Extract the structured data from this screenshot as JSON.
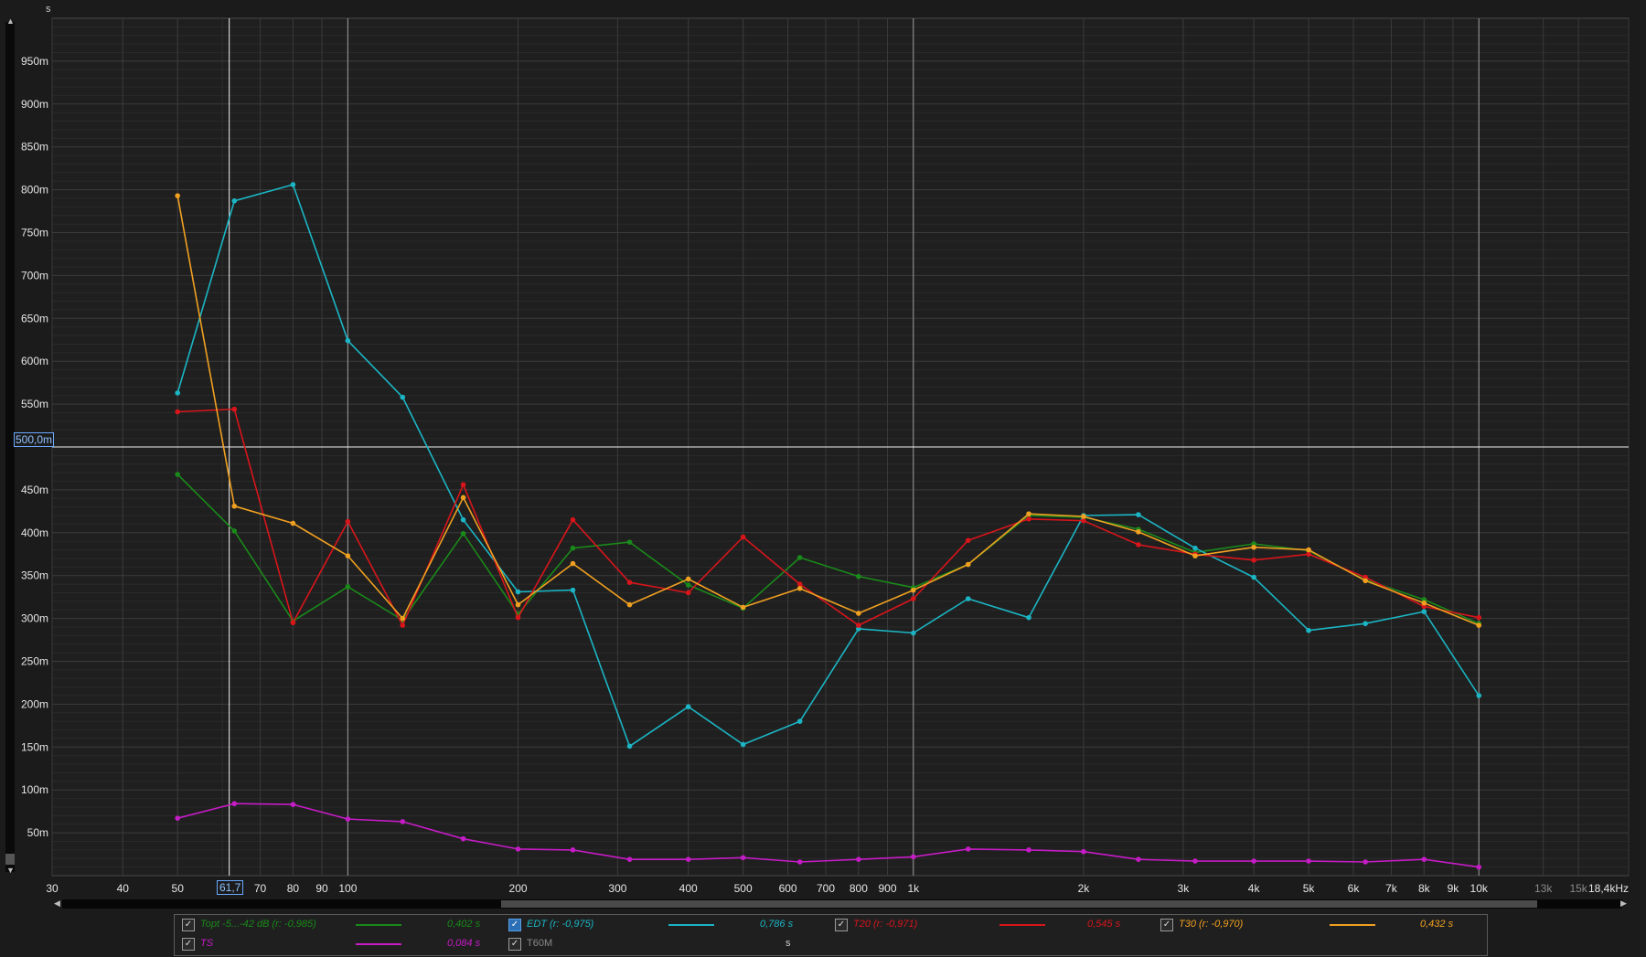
{
  "units": {
    "y_unit": "s",
    "x_unit_suffix": "kHz"
  },
  "cursor": {
    "x_readout": "61,7",
    "y_readout": "500,0m"
  },
  "legend": {
    "row1": [
      {
        "label": "Topt -5...-42 dB (r: -0,985)",
        "value": "0,402 s",
        "color": "#1a8a1a",
        "checked": true
      },
      {
        "label": "EDT (r: -0,975)",
        "value": "0,786 s",
        "color": "#1bb5c4",
        "checked": true
      },
      {
        "label": "T20 (r: -0,971)",
        "value": "0,545 s",
        "color": "#d8151b",
        "checked": true
      },
      {
        "label": "T30 (r: -0,970)",
        "value": "0,432 s",
        "color": "#f0a020",
        "checked": true
      }
    ],
    "row2": [
      {
        "label": "TS",
        "value": "0,084 s",
        "color": "#c61cc6",
        "checked": true
      },
      {
        "label": "T60M",
        "value": "s",
        "color": "#8a8a8a",
        "checked": true
      }
    ]
  },
  "chart_data": {
    "type": "line",
    "x_scale": "log",
    "xlim": [
      30,
      18400
    ],
    "ylim": [
      0,
      1.0
    ],
    "grid": true,
    "y_ticks": [
      {
        "v": 0.05,
        "label": "50m"
      },
      {
        "v": 0.1,
        "label": "100m"
      },
      {
        "v": 0.15,
        "label": "150m"
      },
      {
        "v": 0.2,
        "label": "200m"
      },
      {
        "v": 0.25,
        "label": "250m"
      },
      {
        "v": 0.3,
        "label": "300m"
      },
      {
        "v": 0.35,
        "label": "350m"
      },
      {
        "v": 0.4,
        "label": "400m"
      },
      {
        "v": 0.45,
        "label": "450m"
      },
      {
        "v": 0.55,
        "label": "550m"
      },
      {
        "v": 0.6,
        "label": "600m"
      },
      {
        "v": 0.65,
        "label": "650m"
      },
      {
        "v": 0.7,
        "label": "700m"
      },
      {
        "v": 0.75,
        "label": "750m"
      },
      {
        "v": 0.8,
        "label": "800m"
      },
      {
        "v": 0.85,
        "label": "850m"
      },
      {
        "v": 0.9,
        "label": "900m"
      },
      {
        "v": 0.95,
        "label": "950m"
      }
    ],
    "x_ticks": [
      {
        "v": 30,
        "label": "30"
      },
      {
        "v": 40,
        "label": "40"
      },
      {
        "v": 50,
        "label": "50"
      },
      {
        "v": 70,
        "label": "70"
      },
      {
        "v": 80,
        "label": "80"
      },
      {
        "v": 90,
        "label": "90"
      },
      {
        "v": 100,
        "label": "100"
      },
      {
        "v": 200,
        "label": "200"
      },
      {
        "v": 300,
        "label": "300"
      },
      {
        "v": 400,
        "label": "400"
      },
      {
        "v": 500,
        "label": "500"
      },
      {
        "v": 600,
        "label": "600"
      },
      {
        "v": 700,
        "label": "700"
      },
      {
        "v": 800,
        "label": "800"
      },
      {
        "v": 900,
        "label": "900"
      },
      {
        "v": 1000,
        "label": "1k"
      },
      {
        "v": 2000,
        "label": "2k"
      },
      {
        "v": 3000,
        "label": "3k"
      },
      {
        "v": 4000,
        "label": "4k"
      },
      {
        "v": 5000,
        "label": "5k"
      },
      {
        "v": 6000,
        "label": "6k"
      },
      {
        "v": 7000,
        "label": "7k"
      },
      {
        "v": 8000,
        "label": "8k"
      },
      {
        "v": 9000,
        "label": "9k"
      },
      {
        "v": 10000,
        "label": "10k"
      },
      {
        "v": 13000,
        "label": "13k",
        "dim": true
      },
      {
        "v": 15000,
        "label": "15k",
        "dim": true
      },
      {
        "v": 18400,
        "label": "18,4kHz"
      }
    ],
    "x": [
      50,
      63,
      80,
      100,
      125,
      160,
      200,
      250,
      315,
      400,
      500,
      630,
      800,
      1000,
      1250,
      1600,
      2000,
      2500,
      3150,
      4000,
      5000,
      6300,
      8000,
      10000
    ],
    "series": [
      {
        "name": "Topt -5...-42 dB (r: -0,985)",
        "color": "#1a8a1a",
        "values": [
          0.468,
          0.402,
          0.297,
          0.337,
          0.298,
          0.399,
          0.305,
          0.382,
          0.389,
          0.339,
          0.312,
          0.371,
          0.349,
          0.336,
          0.363,
          0.42,
          0.418,
          0.404,
          0.377,
          0.387,
          0.379,
          0.345,
          0.322,
          0.294
        ]
      },
      {
        "name": "EDT (r: -0,975)",
        "color": "#1bb5c4",
        "values": [
          0.563,
          0.787,
          0.806,
          0.624,
          0.558,
          0.415,
          0.331,
          0.333,
          0.151,
          0.197,
          0.153,
          0.18,
          0.288,
          0.283,
          0.323,
          0.301,
          0.42,
          0.421,
          0.382,
          0.348,
          0.286,
          0.294,
          0.308,
          0.21
        ]
      },
      {
        "name": "T20 (r: -0,971)",
        "color": "#d8151b",
        "values": [
          0.541,
          0.544,
          0.295,
          0.413,
          0.292,
          0.456,
          0.301,
          0.415,
          0.342,
          0.33,
          0.395,
          0.34,
          0.292,
          0.323,
          0.391,
          0.416,
          0.414,
          0.386,
          0.375,
          0.368,
          0.375,
          0.348,
          0.314,
          0.301
        ]
      },
      {
        "name": "T30 (r: -0,970)",
        "color": "#f0a020",
        "values": [
          0.793,
          0.431,
          0.411,
          0.373,
          0.3,
          0.441,
          0.316,
          0.364,
          0.316,
          0.346,
          0.313,
          0.335,
          0.306,
          0.333,
          0.363,
          0.422,
          0.419,
          0.401,
          0.373,
          0.383,
          0.38,
          0.344,
          0.318,
          0.292
        ]
      },
      {
        "name": "TS",
        "color": "#c61cc6",
        "values": [
          0.067,
          0.084,
          0.083,
          0.066,
          0.063,
          0.043,
          0.031,
          0.03,
          0.019,
          0.019,
          0.021,
          0.016,
          0.019,
          0.022,
          0.031,
          0.03,
          0.028,
          0.019,
          0.017,
          0.017,
          0.017,
          0.016,
          0.019,
          0.01
        ]
      }
    ],
    "cursor_lines": {
      "x": 61.7,
      "y": 0.5
    }
  }
}
